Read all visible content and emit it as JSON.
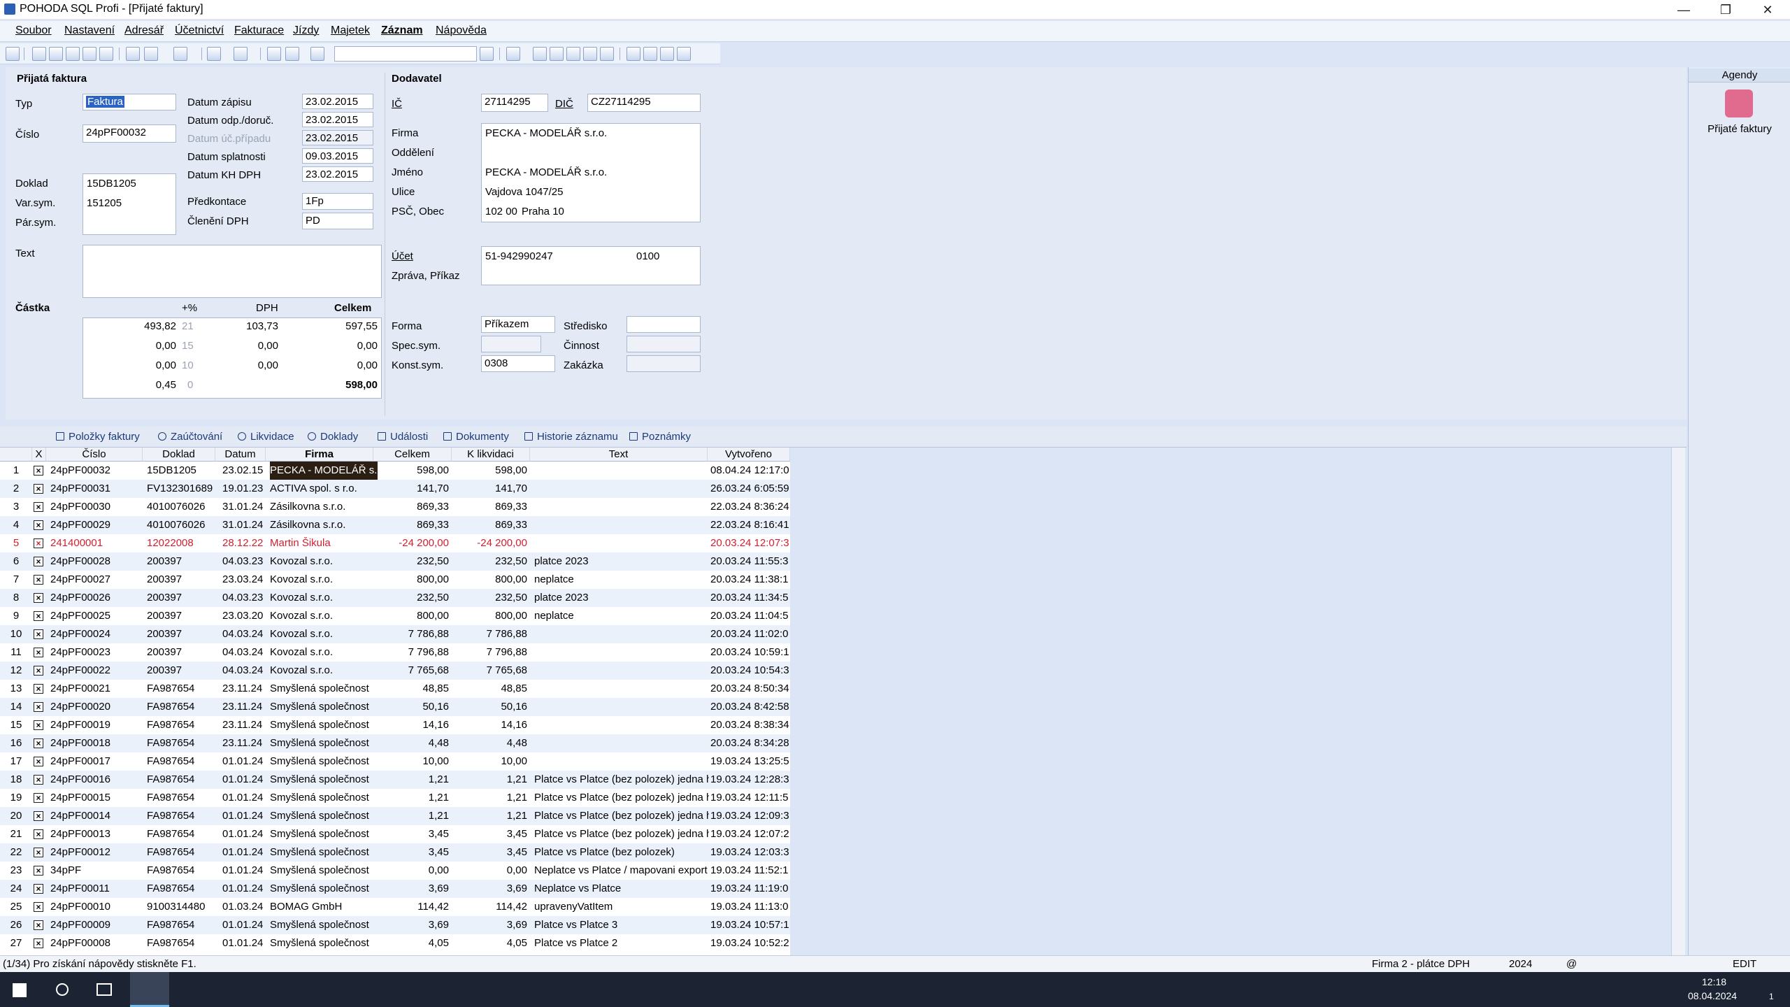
{
  "window": {
    "title": "POHODA SQL Profi - [Přijaté faktury]",
    "minimize": "—",
    "restore": "❐",
    "close": "✕"
  },
  "menu": [
    "Soubor",
    "Nastavení",
    "Adresář",
    "Účetnictví",
    "Fakturace",
    "Jízdy",
    "Majetek",
    "Záznam",
    "Nápověda"
  ],
  "invoice": {
    "section_title": "Přijatá faktura",
    "typ_label": "Typ",
    "typ_value": "Faktura",
    "cislo_label": "Číslo",
    "cislo_value": "24pPF00032",
    "datum_zapisu_label": "Datum zápisu",
    "datum_zapisu": "23.02.2015",
    "datum_odp_label": "Datum odp./doruč.",
    "datum_odp": "23.02.2015",
    "datum_uc_label": "Datum úč.případu",
    "datum_uc": "23.02.2015",
    "datum_splatnosti_label": "Datum splatnosti",
    "datum_splatnosti": "09.03.2015",
    "datum_kh_label": "Datum KH DPH",
    "datum_kh": "23.02.2015",
    "doklad_label": "Doklad",
    "doklad_value": "15DB1205",
    "varsym_label": "Var.sym.",
    "varsym_value": "151205",
    "parsym_label": "Pár.sym.",
    "predkontace_label": "Předkontace",
    "predkontace_value": "1Fp",
    "cleneni_label": "Členění DPH",
    "cleneni_value": "PD",
    "text_label": "Text",
    "castka_label": "Částka",
    "col_pct": "+%",
    "col_dph": "DPH",
    "col_celkem": "Celkem",
    "amounts": [
      {
        "base": "493,82",
        "pct": "21",
        "dph": "103,73",
        "total": "597,55"
      },
      {
        "base": "0,00",
        "pct": "15",
        "dph": "0,00",
        "total": "0,00"
      },
      {
        "base": "0,00",
        "pct": "10",
        "dph": "0,00",
        "total": "0,00"
      },
      {
        "base": "0,45",
        "pct": "0",
        "dph": "",
        "total": "598,00"
      }
    ]
  },
  "supplier": {
    "section_title": "Dodavatel",
    "ic_label": "IČ",
    "ic_value": "27114295",
    "dic_label": "DIČ",
    "dic_value": "CZ27114295",
    "firma_label": "Firma",
    "firma_value": "PECKA - MODELÁŘ s.r.o.",
    "oddeleni_label": "Oddělení",
    "jmeno_label": "Jméno",
    "jmeno_value": "PECKA - MODELÁŘ s.r.o.",
    "ulice_label": "Ulice",
    "ulice_value": "Vajdova 1047/25",
    "psc_label": "PSČ, Obec",
    "psc_value": "102 00",
    "obec_value": "Praha 10",
    "ucet_label": "Účet",
    "ucet_value": "51-942990247",
    "bank_code": "0100",
    "zprava_label": "Zpráva, Příkaz",
    "forma_label": "Forma",
    "forma_value": "Příkazem",
    "specsym_label": "Spec.sym.",
    "konstsym_label": "Konst.sym.",
    "konstsym_value": "0308",
    "stredisko_label": "Středisko",
    "cinnost_label": "Činnost",
    "zakazka_label": "Zakázka"
  },
  "tabs": [
    "Položky faktury",
    "Zaúčtování",
    "Likvidace",
    "Doklady",
    "Události",
    "Dokumenty",
    "Historie záznamu",
    "Poznámky"
  ],
  "grid": {
    "columns": [
      "X",
      "Číslo",
      "Doklad",
      "Datum",
      "Firma",
      "Celkem",
      "K likvidaci",
      "Text",
      "Vytvořeno"
    ],
    "rows": [
      {
        "n": "1",
        "cislo": "24pPF00032",
        "doklad": "15DB1205",
        "datum": "23.02.15",
        "firma": "PECKA - MODELÁŘ s.",
        "celkem": "598,00",
        "lik": "598,00",
        "text": "",
        "vytv": "08.04.24 12:17:0"
      },
      {
        "n": "2",
        "cislo": "24pPF00031",
        "doklad": "FV132301689",
        "datum": "19.01.23",
        "firma": "ACTIVA spol. s r.o.",
        "celkem": "141,70",
        "lik": "141,70",
        "text": "",
        "vytv": "26.03.24 6:05:59"
      },
      {
        "n": "3",
        "cislo": "24pPF00030",
        "doklad": "4010076026",
        "datum": "31.01.24",
        "firma": "Zásilkovna s.r.o.",
        "celkem": "869,33",
        "lik": "869,33",
        "text": "",
        "vytv": "22.03.24 8:36:24"
      },
      {
        "n": "4",
        "cislo": "24pPF00029",
        "doklad": "4010076026",
        "datum": "31.01.24",
        "firma": "Zásilkovna s.r.o.",
        "celkem": "869,33",
        "lik": "869,33",
        "text": "",
        "vytv": "22.03.24 8:16:41"
      },
      {
        "n": "5",
        "cislo": "241400001",
        "doklad": "12022008",
        "datum": "28.12.22",
        "firma": "Martin Šikula",
        "celkem": "-24 200,00",
        "lik": "-24 200,00",
        "text": "",
        "vytv": "20.03.24 12:07:3",
        "red": true
      },
      {
        "n": "6",
        "cislo": "24pPF00028",
        "doklad": "200397",
        "datum": "04.03.23",
        "firma": "Kovozal s.r.o.",
        "celkem": "232,50",
        "lik": "232,50",
        "text": "platce 2023",
        "vytv": "20.03.24 11:55:3"
      },
      {
        "n": "7",
        "cislo": "24pPF00027",
        "doklad": "200397",
        "datum": "23.03.24",
        "firma": "Kovozal s.r.o.",
        "celkem": "800,00",
        "lik": "800,00",
        "text": "neplatce",
        "vytv": "20.03.24 11:38:1"
      },
      {
        "n": "8",
        "cislo": "24pPF00026",
        "doklad": "200397",
        "datum": "04.03.23",
        "firma": "Kovozal s.r.o.",
        "celkem": "232,50",
        "lik": "232,50",
        "text": "platce 2023",
        "vytv": "20.03.24 11:34:5"
      },
      {
        "n": "9",
        "cislo": "24pPF00025",
        "doklad": "200397",
        "datum": "23.03.20",
        "firma": "Kovozal s.r.o.",
        "celkem": "800,00",
        "lik": "800,00",
        "text": "neplatce",
        "vytv": "20.03.24 11:04:5"
      },
      {
        "n": "10",
        "cislo": "24pPF00024",
        "doklad": "200397",
        "datum": "04.03.24",
        "firma": "Kovozal s.r.o.",
        "celkem": "7 786,88",
        "lik": "7 786,88",
        "text": "",
        "vytv": "20.03.24 11:02:0"
      },
      {
        "n": "11",
        "cislo": "24pPF00023",
        "doklad": "200397",
        "datum": "04.03.24",
        "firma": "Kovozal s.r.o.",
        "celkem": "7 796,88",
        "lik": "7 796,88",
        "text": "",
        "vytv": "20.03.24 10:59:1"
      },
      {
        "n": "12",
        "cislo": "24pPF00022",
        "doklad": "200397",
        "datum": "04.03.24",
        "firma": "Kovozal s.r.o.",
        "celkem": "7 765,68",
        "lik": "7 765,68",
        "text": "",
        "vytv": "20.03.24 10:54:3"
      },
      {
        "n": "13",
        "cislo": "24pPF00021",
        "doklad": "FA987654",
        "datum": "23.11.24",
        "firma": "Smyšlená společnost",
        "celkem": "48,85",
        "lik": "48,85",
        "text": "",
        "vytv": "20.03.24 8:50:34"
      },
      {
        "n": "14",
        "cislo": "24pPF00020",
        "doklad": "FA987654",
        "datum": "23.11.24",
        "firma": "Smyšlená společnost",
        "celkem": "50,16",
        "lik": "50,16",
        "text": "",
        "vytv": "20.03.24 8:42:58"
      },
      {
        "n": "15",
        "cislo": "24pPF00019",
        "doklad": "FA987654",
        "datum": "23.11.24",
        "firma": "Smyšlená společnost",
        "celkem": "14,16",
        "lik": "14,16",
        "text": "",
        "vytv": "20.03.24 8:38:34"
      },
      {
        "n": "16",
        "cislo": "24pPF00018",
        "doklad": "FA987654",
        "datum": "23.11.24",
        "firma": "Smyšlená společnost",
        "celkem": "4,48",
        "lik": "4,48",
        "text": "",
        "vytv": "20.03.24 8:34:28"
      },
      {
        "n": "17",
        "cislo": "24pPF00017",
        "doklad": "FA987654",
        "datum": "01.01.24",
        "firma": "Smyšlená společnost",
        "celkem": "10,00",
        "lik": "10,00",
        "text": "",
        "vytv": "19.03.24 13:25:5"
      },
      {
        "n": "18",
        "cislo": "24pPF00016",
        "doklad": "FA987654",
        "datum": "01.01.24",
        "firma": "Smyšlená společnost",
        "celkem": "1,21",
        "lik": "1,21",
        "text": "Platce vs Platce (bez polozek) jedna h",
        "vytv": "19.03.24 12:28:3"
      },
      {
        "n": "19",
        "cislo": "24pPF00015",
        "doklad": "FA987654",
        "datum": "01.01.24",
        "firma": "Smyšlená společnost",
        "celkem": "1,21",
        "lik": "1,21",
        "text": "Platce vs Platce (bez polozek) jedna h",
        "vytv": "19.03.24 12:11:5"
      },
      {
        "n": "20",
        "cislo": "24pPF00014",
        "doklad": "FA987654",
        "datum": "01.01.24",
        "firma": "Smyšlená společnost",
        "celkem": "1,21",
        "lik": "1,21",
        "text": "Platce vs Platce (bez polozek) jedna h",
        "vytv": "19.03.24 12:09:3"
      },
      {
        "n": "21",
        "cislo": "24pPF00013",
        "doklad": "FA987654",
        "datum": "01.01.24",
        "firma": "Smyšlená společnost",
        "celkem": "3,45",
        "lik": "3,45",
        "text": "Platce vs Platce (bez polozek) jedna h",
        "vytv": "19.03.24 12:07:2"
      },
      {
        "n": "22",
        "cislo": "24pPF00012",
        "doklad": "FA987654",
        "datum": "01.01.24",
        "firma": "Smyšlená společnost",
        "celkem": "3,45",
        "lik": "3,45",
        "text": "Platce vs Platce (bez polozek)",
        "vytv": "19.03.24 12:03:3"
      },
      {
        "n": "23",
        "cislo": "34pPF",
        "doklad": "FA987654",
        "datum": "01.01.24",
        "firma": "Smyšlená společnost",
        "celkem": "0,00",
        "lik": "0,00",
        "text": "Neplatce vs Platce / mapovani export",
        "vytv": "19.03.24 11:52:1"
      },
      {
        "n": "24",
        "cislo": "24pPF00011",
        "doklad": "FA987654",
        "datum": "01.01.24",
        "firma": "Smyšlená společnost",
        "celkem": "3,69",
        "lik": "3,69",
        "text": "Neplatce vs Platce",
        "vytv": "19.03.24 11:19:0"
      },
      {
        "n": "25",
        "cislo": "24pPF00010",
        "doklad": "9100314480",
        "datum": "01.03.24",
        "firma": "BOMAG GmbH",
        "celkem": "114,42",
        "lik": "114,42",
        "text": "upravenyVatItem",
        "vytv": "19.03.24 11:13:0"
      },
      {
        "n": "26",
        "cislo": "24pPF00009",
        "doklad": "FA987654",
        "datum": "01.01.24",
        "firma": "Smyšlená společnost",
        "celkem": "3,69",
        "lik": "3,69",
        "text": "Platce vs Platce 3",
        "vytv": "19.03.24 10:57:1"
      },
      {
        "n": "27",
        "cislo": "24pPF00008",
        "doklad": "FA987654",
        "datum": "01.01.24",
        "firma": "Smyšlená společnost",
        "celkem": "4,05",
        "lik": "4,05",
        "text": "Platce vs Platce 2",
        "vytv": "19.03.24 10:52:2"
      }
    ]
  },
  "agendy": {
    "title": "Agendy",
    "item": "Přijaté faktury"
  },
  "status": {
    "hint": "(1/34) Pro získání nápovědy stiskněte F1.",
    "company": "Firma 2 - plátce DPH",
    "year": "2024",
    "at": "@",
    "mode": "EDIT"
  },
  "taskbar": {
    "time": "12:18",
    "date": "08.04.2024",
    "badge": "1"
  }
}
